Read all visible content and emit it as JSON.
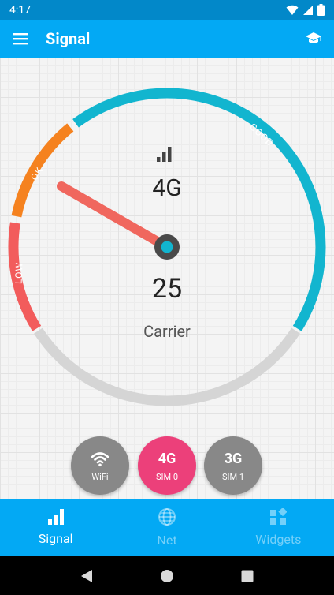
{
  "status_bar": {
    "time": "4:17"
  },
  "app_bar": {
    "title": "Signal"
  },
  "gauge": {
    "network_type": "4G",
    "value": "25",
    "operator": "Carrier",
    "labels": {
      "good": "GOOD",
      "ok": "OK",
      "low": "LOW"
    },
    "colors": {
      "good": "#12b5cf",
      "ok": "#f5821f",
      "low": "#f25c5c",
      "track": "#d5d5d5",
      "needle": "#f0675e",
      "hub": "#4a4a4a",
      "hub_center": "#12b5cf"
    }
  },
  "sim_buttons": [
    {
      "title_icon": "wifi-icon",
      "label": "WiFi",
      "color": "#888888"
    },
    {
      "title": "4G",
      "label": "SIM 0",
      "color": "#ec407a"
    },
    {
      "title": "3G",
      "label": "SIM 1",
      "color": "#888888"
    }
  ],
  "bottom_nav": [
    {
      "label": "Signal",
      "icon": "signal-bars-icon",
      "active": true
    },
    {
      "label": "Net",
      "icon": "globe-icon",
      "active": false
    },
    {
      "label": "Widgets",
      "icon": "widgets-icon",
      "active": false
    }
  ]
}
